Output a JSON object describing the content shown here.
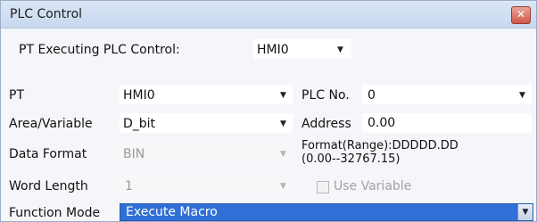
{
  "window": {
    "title": "PLC Control",
    "close_glyph": "✕"
  },
  "pt_executing": {
    "label": "PT Executing PLC Control:",
    "value": "HMI0"
  },
  "pt": {
    "label": "PT",
    "value": "HMI0"
  },
  "plc_no": {
    "label": "PLC No.",
    "value": "0"
  },
  "area": {
    "label": "Area/Variable",
    "value": "D_bit"
  },
  "address": {
    "label": "Address",
    "value": "0.00"
  },
  "data_format": {
    "label": "Data Format",
    "value": "BIN",
    "format_range_line1": "Format(Range):DDDDD.DD",
    "format_range_line2": "(0.00--32767.15)"
  },
  "word_length": {
    "label": "Word Length",
    "value": "1"
  },
  "use_variable": {
    "label": "Use Variable",
    "checked": false,
    "enabled": false
  },
  "function_mode": {
    "label": "Function Mode",
    "value": "Execute Macro"
  },
  "icons": {
    "dropdown_arrow": "▼",
    "close": "close-icon"
  }
}
